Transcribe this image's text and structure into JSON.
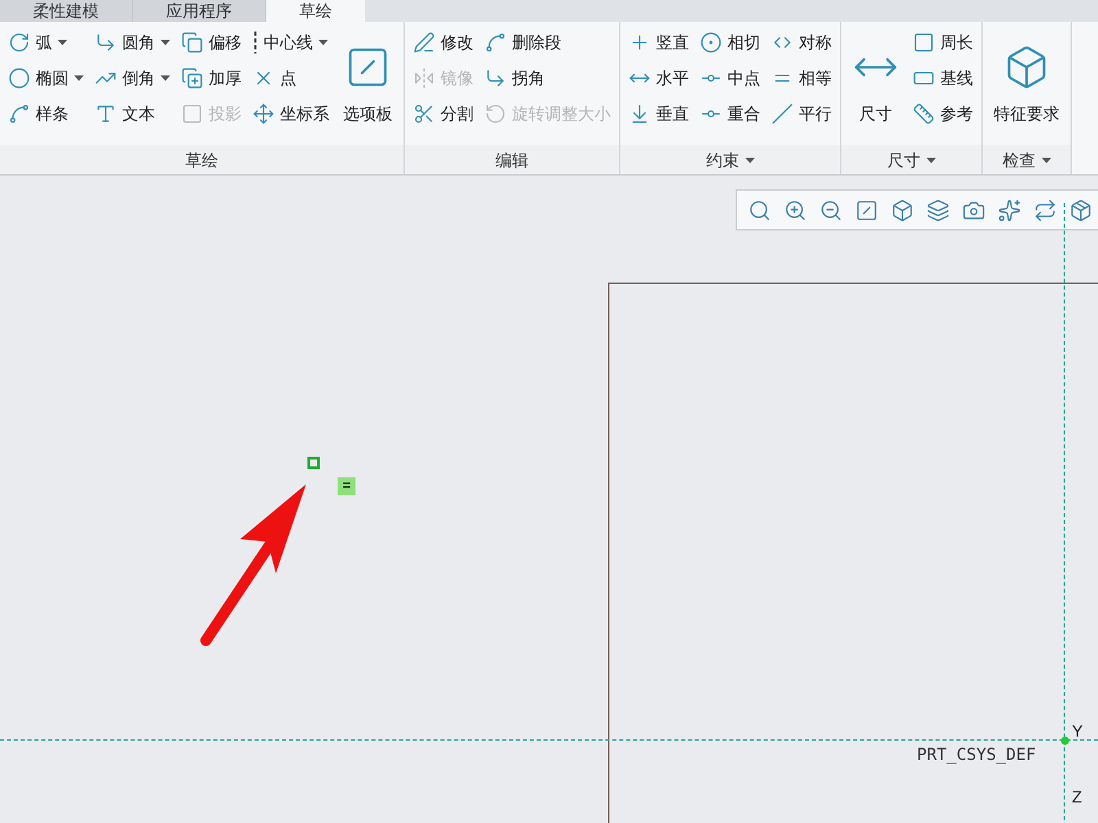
{
  "tabs": [
    {
      "label": "柔性建模",
      "selected": false
    },
    {
      "label": "应用程序",
      "selected": false
    },
    {
      "label": "草绘",
      "selected": true
    }
  ],
  "groups": [
    {
      "label": "草绘",
      "dropdown": false,
      "items": [
        {
          "kind": "column",
          "tools": [
            {
              "label": "弧",
              "dropdown": true,
              "disabled": false
            },
            {
              "label": "椭圆",
              "dropdown": true,
              "disabled": false
            },
            {
              "label": "样条",
              "dropdown": false,
              "disabled": false
            }
          ]
        },
        {
          "kind": "column",
          "tools": [
            {
              "label": "圆角",
              "dropdown": true,
              "disabled": false
            },
            {
              "label": "倒角",
              "dropdown": true,
              "disabled": false
            },
            {
              "label": "文本",
              "dropdown": false,
              "disabled": false
            }
          ]
        },
        {
          "kind": "column",
          "tools": [
            {
              "label": "偏移",
              "dropdown": false,
              "disabled": false
            },
            {
              "label": "加厚",
              "dropdown": false,
              "disabled": false
            },
            {
              "label": "投影",
              "dropdown": false,
              "disabled": true
            }
          ]
        },
        {
          "kind": "column",
          "tools": [
            {
              "label": "中心线",
              "dropdown": true,
              "disabled": false
            },
            {
              "label": "点",
              "dropdown": false,
              "disabled": false
            },
            {
              "label": "坐标系",
              "dropdown": false,
              "disabled": false
            }
          ]
        },
        {
          "kind": "large",
          "label": "选项板"
        }
      ]
    },
    {
      "label": "编辑",
      "dropdown": false,
      "items": [
        {
          "kind": "column",
          "tools": [
            {
              "label": "修改",
              "dropdown": false,
              "disabled": false
            },
            {
              "label": "镜像",
              "dropdown": false,
              "disabled": true
            },
            {
              "label": "分割",
              "dropdown": false,
              "disabled": false
            }
          ]
        },
        {
          "kind": "column",
          "tools": [
            {
              "label": "删除段",
              "dropdown": false,
              "disabled": false
            },
            {
              "label": "拐角",
              "dropdown": false,
              "disabled": false
            },
            {
              "label": "旋转调整大小",
              "dropdown": false,
              "disabled": true
            }
          ]
        }
      ]
    },
    {
      "label": "约束",
      "dropdown": true,
      "items": [
        {
          "kind": "column",
          "tools": [
            {
              "label": "竖直",
              "dropdown": false,
              "disabled": false
            },
            {
              "label": "水平",
              "dropdown": false,
              "disabled": false
            },
            {
              "label": "垂直",
              "dropdown": false,
              "disabled": false
            }
          ]
        },
        {
          "kind": "column",
          "tools": [
            {
              "label": "相切",
              "dropdown": false,
              "disabled": false
            },
            {
              "label": "中点",
              "dropdown": false,
              "disabled": false
            },
            {
              "label": "重合",
              "dropdown": false,
              "disabled": false
            }
          ]
        },
        {
          "kind": "column",
          "tools": [
            {
              "label": "对称",
              "dropdown": false,
              "disabled": false
            },
            {
              "label": "相等",
              "dropdown": false,
              "disabled": false
            },
            {
              "label": "平行",
              "dropdown": false,
              "disabled": false
            }
          ]
        }
      ]
    },
    {
      "label": "尺寸",
      "dropdown": true,
      "items": [
        {
          "kind": "large",
          "label": "尺寸"
        },
        {
          "kind": "column",
          "tools": [
            {
              "label": "周长",
              "dropdown": false,
              "disabled": false
            },
            {
              "label": "基线",
              "dropdown": false,
              "disabled": false
            },
            {
              "label": "参考",
              "dropdown": false,
              "disabled": false
            }
          ]
        }
      ]
    },
    {
      "label": "检查",
      "dropdown": true,
      "items": [
        {
          "kind": "large",
          "label": "特征要求"
        }
      ]
    }
  ],
  "canvas": {
    "constraint_badge": "=",
    "axis_labels": [
      "Y",
      "Z"
    ],
    "csys_label": "PRT_CSYS_DEF"
  }
}
